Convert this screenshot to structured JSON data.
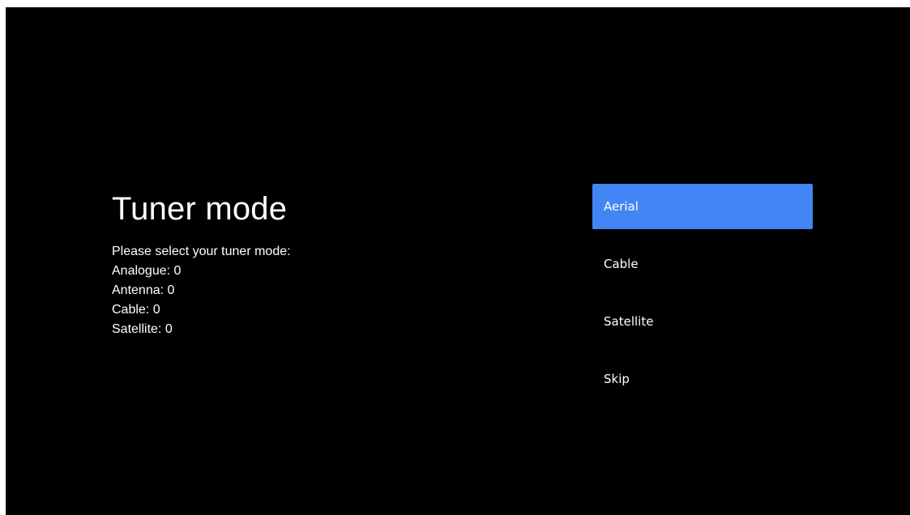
{
  "screen": {
    "title": "Tuner mode",
    "description_lines": [
      "Please select your tuner mode:",
      "Analogue: 0",
      "Antenna: 0",
      "Cable: 0",
      "Satellite: 0"
    ]
  },
  "menu": {
    "items": [
      {
        "label": "Aerial",
        "selected": true
      },
      {
        "label": "Cable",
        "selected": false
      },
      {
        "label": "Satellite",
        "selected": false
      },
      {
        "label": "Skip",
        "selected": false
      }
    ]
  },
  "colors": {
    "background": "#000000",
    "highlight": "#4285f4",
    "text": "#ffffff"
  }
}
